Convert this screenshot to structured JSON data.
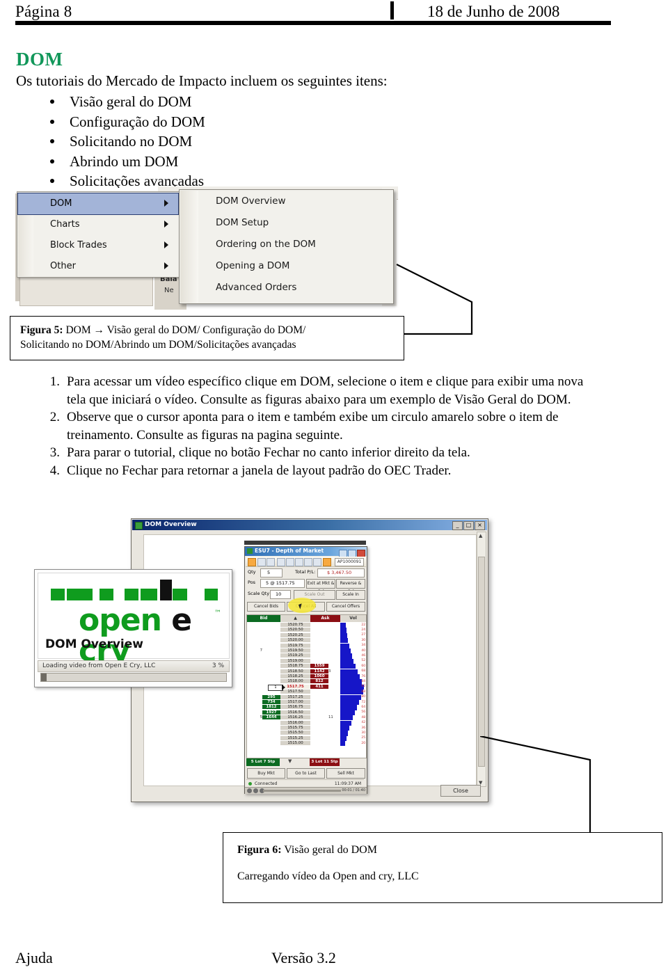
{
  "header": {
    "page_label": "Página 8",
    "date": "18 de Junho de 2008"
  },
  "section": {
    "title": "DOM",
    "title_color": "#11975a",
    "intro": "Os tutoriais do Mercado de Impacto incluem os seguintes itens:",
    "bullets": [
      "Visão geral do DOM",
      "Configuração do DOM",
      "Solicitando no DOM",
      "Abrindo um DOM",
      "Solicitações avançadas"
    ]
  },
  "menu_screenshot": {
    "left_menu": [
      {
        "label": "DOM",
        "selected": true
      },
      {
        "label": "Charts",
        "selected": false
      },
      {
        "label": "Block Trades",
        "selected": false
      },
      {
        "label": "Other",
        "selected": false
      }
    ],
    "submenu": [
      "DOM Overview",
      "DOM Setup",
      "Ordering on the DOM",
      "Opening a DOM",
      "Advanced Orders"
    ],
    "background_fragments": [
      "Bala",
      "Ne"
    ]
  },
  "figure5": {
    "label": "Figura 5:",
    "line1": " DOM → Visão geral do DOM/ Configuração do DOM/",
    "line2": "Solicitando no DOM/Abrindo um DOM/Solicitações avançadas"
  },
  "steps": [
    {
      "num": "1.",
      "text": "Para acessar um vídeo específico clique em DOM, selecione o item e clique para exibir uma nova tela que iniciará o vídeo. Consulte as figuras abaixo para um exemplo de Visão Geral do DOM."
    },
    {
      "num": "2.",
      "text": "Observe que o cursor aponta para o item e também exibe um circulo amarelo sobre o item de treinamento. Consulte as figuras na pagina seguinte."
    },
    {
      "num": "3.",
      "text": "Para parar o tutorial, clique no botão Fechar no canto inferior direito da tela."
    },
    {
      "num": "4.",
      "text": "Clique no Fechar para retornar a janela de layout padrão do OEC Trader."
    }
  ],
  "app_screenshot": {
    "window_title": "DOM Overview",
    "window_buttons": [
      "_",
      "□",
      "×"
    ],
    "close_button": "Close",
    "scroll_up": "▲",
    "scroll_down": "▼",
    "splash": {
      "logo_text_open": "open",
      "logo_text_e": "e",
      "logo_text_cry": "cry",
      "logo_tm": "™",
      "logo_green": "#0f9c1e",
      "caption": "DOM Overview",
      "loading_text": "Loading video from Open E Cry, LLC",
      "loading_percent": "3 %",
      "progress_value": 3
    },
    "dom_window": {
      "title": "ESU7 - Depth of Market",
      "account": "AP1000091",
      "fields": [
        {
          "label": "Qty",
          "value": "5"
        },
        {
          "label": "Total P/L:",
          "value": "$ 3,467.50"
        },
        {
          "label": "Pos",
          "value": "5 @ 1517.75"
        },
        {
          "label": "Scale Qty",
          "value": "10"
        }
      ],
      "buttons": [
        "Exit at Mkt & Cxl",
        "Reverse & Cxl",
        "Scale Out",
        "Scale In",
        "Cancel Bids",
        "Cancel All",
        "Cancel Offers",
        "Buy Mkt",
        "Go to Last",
        "Sell Mkt"
      ],
      "ladder_headers": [
        "Bid",
        "",
        "Ask",
        "Vol"
      ],
      "ladder_rows": [
        {
          "bidq": "",
          "bid": "",
          "price": "1520.75",
          "ask": "",
          "askq": "",
          "vol": 22
        },
        {
          "bidq": "",
          "bid": "",
          "price": "1520.50",
          "ask": "",
          "askq": "",
          "vol": 24
        },
        {
          "bidq": "",
          "bid": "",
          "price": "1520.25",
          "ask": "",
          "askq": "",
          "vol": 27
        },
        {
          "bidq": "",
          "bid": "",
          "price": "1520.00",
          "ask": "",
          "askq": "",
          "vol": 30
        },
        {
          "bidq": "",
          "bid": "",
          "price": "1519.75",
          "ask": "",
          "askq": "",
          "vol": 34
        },
        {
          "bidq": "7",
          "bid": "",
          "price": "1519.50",
          "ask": "",
          "askq": "",
          "vol": 40
        },
        {
          "bidq": "",
          "bid": "",
          "price": "1519.25",
          "ask": "",
          "askq": "",
          "vol": 46
        },
        {
          "bidq": "",
          "bid": "",
          "price": "1519.00",
          "ask": "",
          "askq": "",
          "vol": 52
        },
        {
          "bidq": "",
          "bid": "",
          "price": "1518.75",
          "ask": "1559",
          "askq": "",
          "vol": 60
        },
        {
          "bidq": "",
          "bid": "",
          "price": "1518.50",
          "ask": "1142",
          "askq": "3",
          "vol": 68
        },
        {
          "bidq": "",
          "bid": "",
          "price": "1518.25",
          "ask": "1060",
          "askq": "",
          "vol": 76
        },
        {
          "bidq": "",
          "bid": "",
          "price": "1518.00",
          "ask": "812",
          "askq": "",
          "vol": 84
        },
        {
          "bidq": "",
          "bid": "",
          "price": "1517.75",
          "ask": "411",
          "askq": "",
          "vol": 92,
          "last": true
        },
        {
          "bidq": "",
          "bid": "",
          "price": "1517.50",
          "ask": "",
          "askq": "",
          "vol": 88
        },
        {
          "bidq": "",
          "bid": "295",
          "price": "1517.25",
          "ask": "",
          "askq": "",
          "vol": 80
        },
        {
          "bidq": "",
          "bid": "734",
          "price": "1517.00",
          "ask": "",
          "askq": "",
          "vol": 72
        },
        {
          "bidq": "",
          "bid": "1812",
          "price": "1516.75",
          "ask": "",
          "askq": "",
          "vol": 64
        },
        {
          "bidq": "",
          "bid": "1927",
          "price": "1516.50",
          "ask": "",
          "askq": "",
          "vol": 56
        },
        {
          "bidq": "5",
          "bid": "1644",
          "price": "1516.25",
          "ask": "",
          "askq": "11",
          "vol": 48
        },
        {
          "bidq": "",
          "bid": "",
          "price": "1516.00",
          "ask": "",
          "askq": "",
          "vol": 42
        },
        {
          "bidq": "",
          "bid": "",
          "price": "1515.75",
          "ask": "",
          "askq": "",
          "vol": 36
        },
        {
          "bidq": "",
          "bid": "",
          "price": "1515.50",
          "ask": "",
          "askq": "",
          "vol": 30
        },
        {
          "bidq": "",
          "bid": "",
          "price": "1515.25",
          "ask": "",
          "askq": "",
          "vol": 25
        },
        {
          "bidq": "",
          "bid": "",
          "price": "1515.00",
          "ask": "",
          "askq": "",
          "vol": 20
        }
      ],
      "order_tag": "1",
      "summary_bid": "5 Lot 7 Stp",
      "summary_ask": "3 Lot 11 Stp",
      "status": "Connected",
      "time": "11:09:37 AM",
      "player_time": "00:01 / 01:40"
    }
  },
  "figure6": {
    "label": "Figura 6:",
    "title": " Visão geral do DOM",
    "subtitle": "Carregando vídeo da Open and cry, LLC"
  },
  "footer": {
    "left": "Ajuda",
    "center": "Versão 3.2"
  }
}
